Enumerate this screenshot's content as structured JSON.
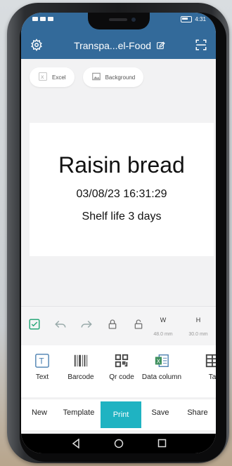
{
  "status": {
    "time": "4:31"
  },
  "header": {
    "title": "Transpa...el-Food"
  },
  "chips": [
    {
      "label": "Excel",
      "icon": "excel-icon"
    },
    {
      "label": "Background",
      "icon": "image-icon"
    }
  ],
  "label": {
    "title": "Raisin bread",
    "date": "03/08/23 16:31:29",
    "shelf": "Shelf life 3 days"
  },
  "dimensions": {
    "w_label": "W",
    "w_value": "48.0 mm",
    "h_label": "H",
    "h_value": "30.0 mm"
  },
  "elements": [
    {
      "label": "Text",
      "icon": "text-icon"
    },
    {
      "label": "Barcode",
      "icon": "barcode-icon"
    },
    {
      "label": "Qr code",
      "icon": "qr-code-icon"
    },
    {
      "label": "Data column",
      "icon": "data-column-icon"
    },
    {
      "label": "Ta",
      "icon": "table-icon"
    }
  ],
  "bottom": {
    "new": "New",
    "template": "Template",
    "print": "Print",
    "save": "Save",
    "share": "Share"
  },
  "colors": {
    "header": "#336a9a",
    "accent": "#1fb3c2",
    "check": "#2aa87a"
  }
}
